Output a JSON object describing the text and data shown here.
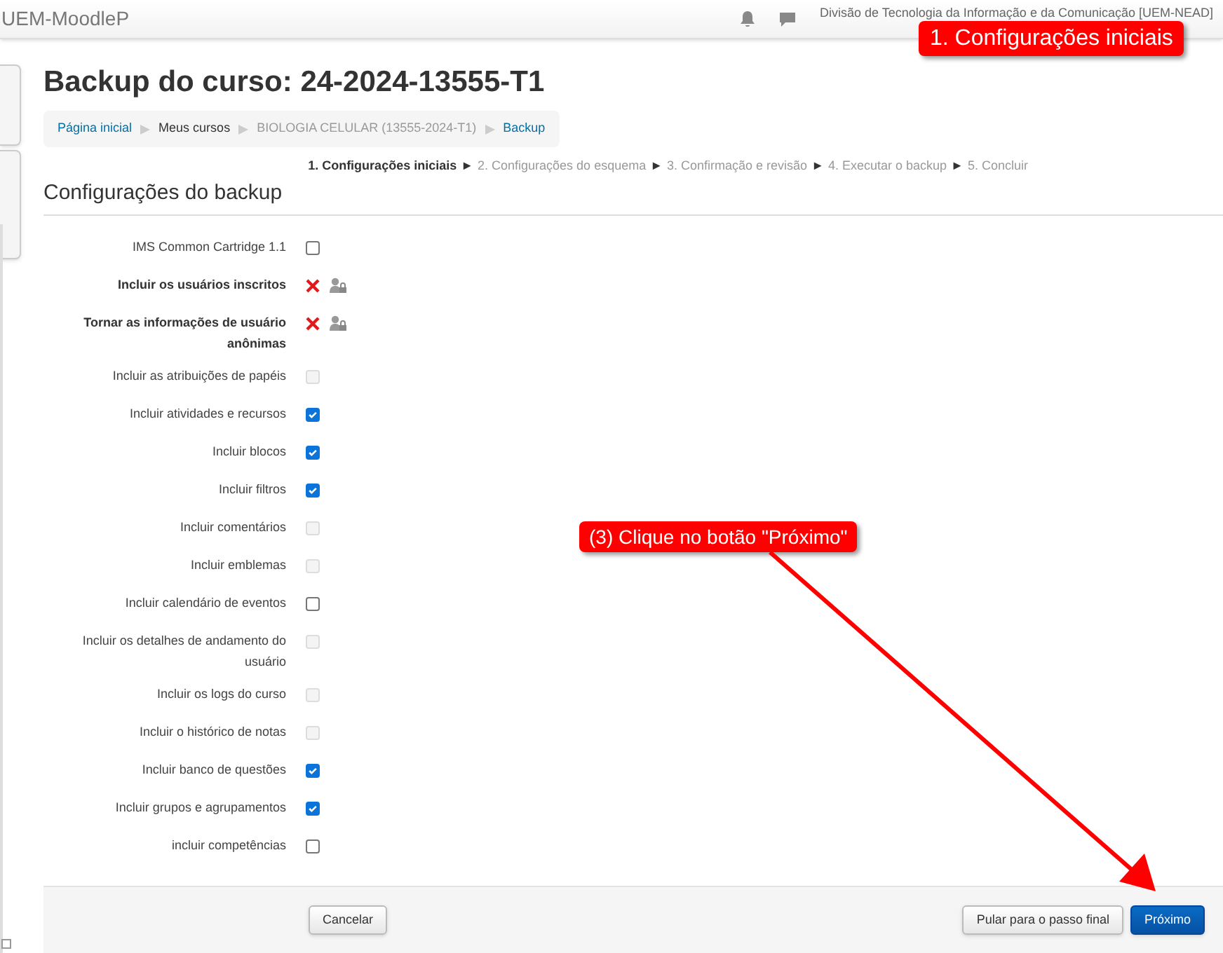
{
  "header": {
    "site_name": "UEM-MoodleP",
    "user_text": "Divisão de Tecnologia da Informação e da Comunicação [UEM-NEAD]"
  },
  "page_title": "Backup do curso: 24-2024-13555-T1",
  "breadcrumb": [
    {
      "label": "Página inicial",
      "kind": "link"
    },
    {
      "label": "Meus cursos",
      "kind": "text"
    },
    {
      "label": "BIOLOGIA CELULAR (13555-2024-T1)",
      "kind": "muted"
    },
    {
      "label": "Backup",
      "kind": "link"
    }
  ],
  "steps": [
    {
      "label": "1. Configurações iniciais",
      "selected": true
    },
    {
      "label": "2. Configurações do esquema",
      "selected": false
    },
    {
      "label": "3. Confirmação e revisão",
      "selected": false
    },
    {
      "label": "4. Executar o backup",
      "selected": false
    },
    {
      "label": "5. Concluir",
      "selected": false
    }
  ],
  "step_separator": "►",
  "section_title": "Configurações do backup",
  "settings": [
    {
      "label": "IMS Common Cartridge 1.1",
      "kind": "checkbox",
      "checked": false,
      "disabled": false
    },
    {
      "label": "Incluir os usuários inscritos",
      "kind": "locked"
    },
    {
      "label": "Tornar as informações de usuário anônimas",
      "kind": "locked"
    },
    {
      "label": "Incluir as atribuições de papéis",
      "kind": "checkbox",
      "checked": false,
      "disabled": true
    },
    {
      "label": "Incluir atividades e recursos",
      "kind": "checkbox",
      "checked": true,
      "disabled": false
    },
    {
      "label": "Incluir blocos",
      "kind": "checkbox",
      "checked": true,
      "disabled": false
    },
    {
      "label": "Incluir filtros",
      "kind": "checkbox",
      "checked": true,
      "disabled": false
    },
    {
      "label": "Incluir comentários",
      "kind": "checkbox",
      "checked": false,
      "disabled": true
    },
    {
      "label": "Incluir emblemas",
      "kind": "checkbox",
      "checked": false,
      "disabled": true
    },
    {
      "label": "Incluir calendário de eventos",
      "kind": "checkbox",
      "checked": false,
      "disabled": false
    },
    {
      "label": "Incluir os detalhes de andamento do usuário",
      "kind": "checkbox",
      "checked": false,
      "disabled": true
    },
    {
      "label": "Incluir os logs do curso",
      "kind": "checkbox",
      "checked": false,
      "disabled": true
    },
    {
      "label": "Incluir o histórico de notas",
      "kind": "checkbox",
      "checked": false,
      "disabled": true
    },
    {
      "label": "Incluir banco de questões",
      "kind": "checkbox",
      "checked": true,
      "disabled": false
    },
    {
      "label": "Incluir grupos e agrupamentos",
      "kind": "checkbox",
      "checked": true,
      "disabled": false
    },
    {
      "label": "incluir competências",
      "kind": "checkbox",
      "checked": false,
      "disabled": false
    }
  ],
  "buttons": [
    {
      "label": "Cancelar",
      "kind": "secondary"
    },
    {
      "label": "Pular para o passo final",
      "kind": "secondary"
    },
    {
      "label": "Próximo",
      "kind": "primary"
    }
  ],
  "annotations": [
    {
      "text": "1. Configurações iniciais"
    },
    {
      "text": "(3) Clique no botão \"Próximo\""
    }
  ]
}
